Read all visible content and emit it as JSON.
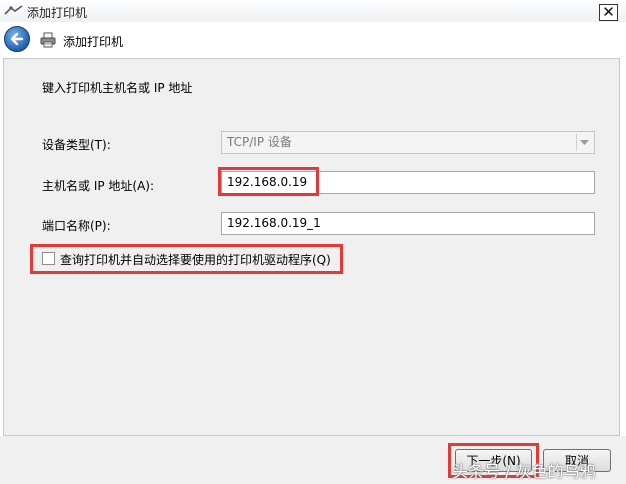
{
  "window": {
    "title": "添加打印机",
    "close_glyph": "✕"
  },
  "header": {
    "title": "添加打印机",
    "back_icon": "back-arrow-icon",
    "printer_icon": "printer-icon"
  },
  "form": {
    "heading": "键入打印机主机名或 IP 地址",
    "device_type_label": "设备类型(T):",
    "device_type_value": "TCP/IP 设备",
    "hostname_label": "主机名或 IP 地址(A):",
    "hostname_value": "192.168.0.19",
    "port_label": "端口名称(P):",
    "port_value": "192.168.0.19_1",
    "auto_driver_label": "查询打印机并自动选择要使用的打印机驱动程序(Q)",
    "auto_driver_checked": false
  },
  "buttons": {
    "next": "下一步(N)",
    "cancel": "取消"
  },
  "watermark": "头条号 / 灰色的乌鸦",
  "colors": {
    "highlight": "#e23a3a",
    "content_bg": "#f0f0f0",
    "back_button": "#1f5fb3"
  }
}
